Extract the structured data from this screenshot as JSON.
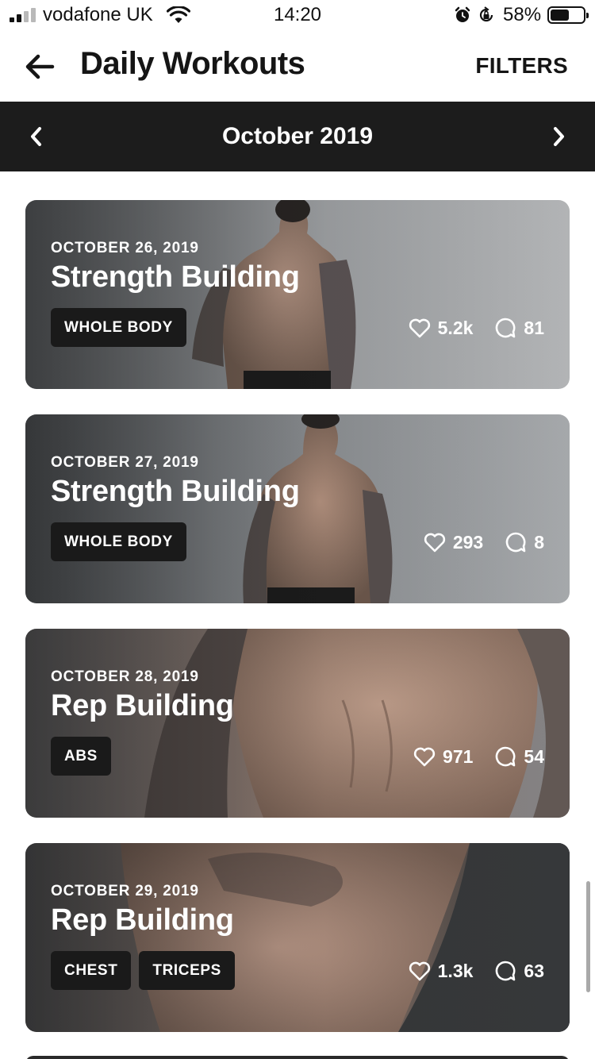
{
  "status_bar": {
    "carrier": "vodafone UK",
    "time": "14:20",
    "battery_percent": "58%",
    "battery_level": 0.58,
    "icons": [
      "signal-icon",
      "wifi-icon",
      "alarm-icon",
      "rotation-lock-icon",
      "battery-icon"
    ]
  },
  "header": {
    "title": "Daily Workouts",
    "filters_label": "FILTERS",
    "back_icon": "arrow-left-icon"
  },
  "month_nav": {
    "label": "October 2019",
    "prev_icon": "chevron-left-icon",
    "next_icon": "chevron-right-icon"
  },
  "workouts": [
    {
      "date": "OCTOBER 26, 2019",
      "title": "Strength Building",
      "tags": [
        "WHOLE BODY"
      ],
      "likes": "5.2k",
      "comments": "81"
    },
    {
      "date": "OCTOBER 27, 2019",
      "title": "Strength Building",
      "tags": [
        "WHOLE BODY"
      ],
      "likes": "293",
      "comments": "8"
    },
    {
      "date": "OCTOBER 28, 2019",
      "title": "Rep Building",
      "tags": [
        "ABS"
      ],
      "likes": "971",
      "comments": "54"
    },
    {
      "date": "OCTOBER 29, 2019",
      "title": "Rep Building",
      "tags": [
        "CHEST",
        "TRICEPS"
      ],
      "likes": "1.3k",
      "comments": "63"
    }
  ],
  "colors": {
    "month_bar": "#1c1c1c",
    "tag_bg": "#1a1a1a",
    "text_dark": "#151515",
    "card_text": "#ffffff"
  }
}
